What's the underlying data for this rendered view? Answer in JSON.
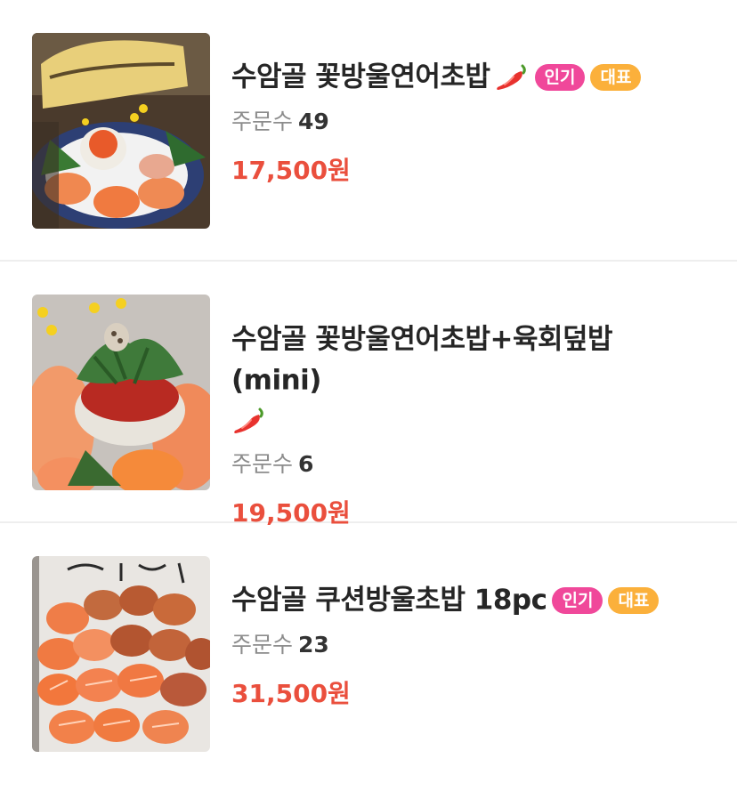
{
  "menu": {
    "items": [
      {
        "name": "수암골 꽃방울연어초밥",
        "spicy_icon": "chili-pepper-icon",
        "badges": {
          "popular": "인기",
          "signature": "대표"
        },
        "orders_label": "주문수",
        "orders_count": "49",
        "price": "17,500원",
        "image": "salmon-sushi-flower-platter-photo"
      },
      {
        "name": "수암골 꽃방울연어초밥+육회덮밥(mini)",
        "spicy_icon": "chili-pepper-icon",
        "orders_label": "주문수",
        "orders_count": "6",
        "price": "19,500원",
        "image": "salmon-sushi-yukhoe-bowl-photo"
      },
      {
        "name": "수암골 쿠션방울초밥 18pc",
        "badges": {
          "popular": "인기",
          "signature": "대표"
        },
        "orders_label": "주문수",
        "orders_count": "23",
        "price": "31,500원",
        "image": "cushion-salmon-sushi-18pc-photo"
      }
    ]
  },
  "colors": {
    "price": "#ea4f3d",
    "badge_popular": "#f0489a",
    "badge_signature": "#fbb03b",
    "divider": "#eeeeee",
    "label_gray": "#8c8c8c"
  }
}
